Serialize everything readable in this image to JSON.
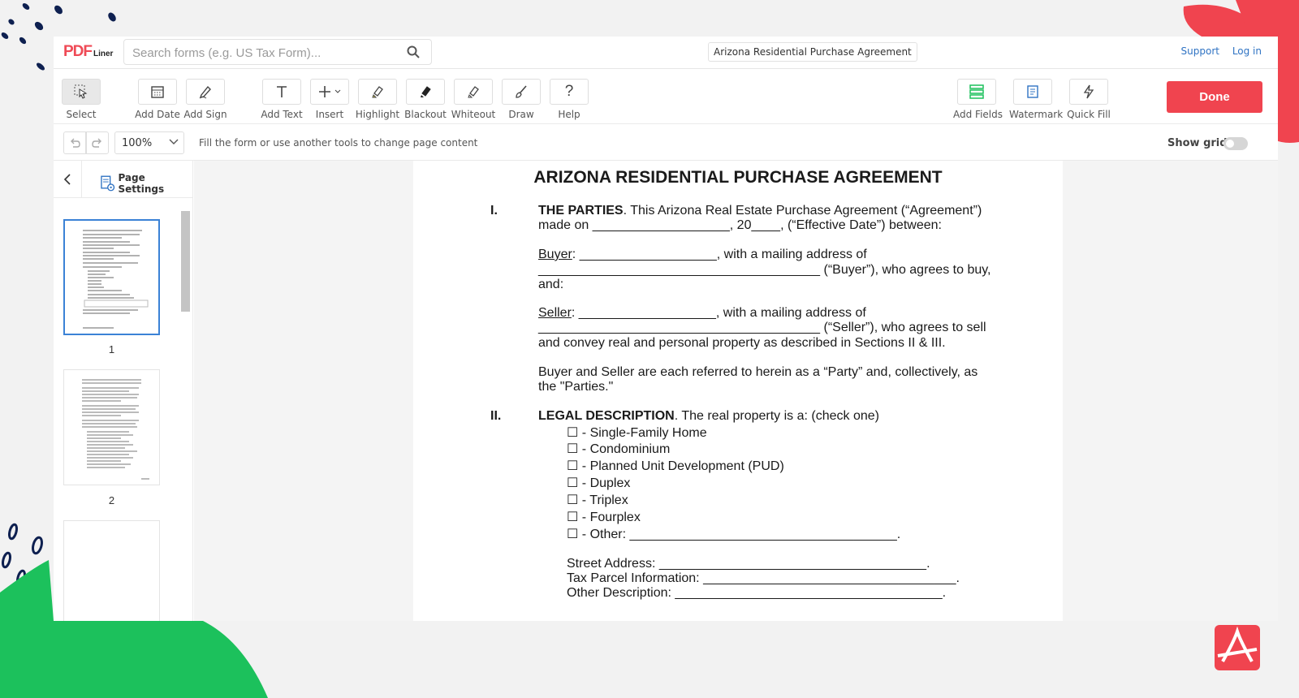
{
  "app": {
    "logo_main": "PDF",
    "logo_sub": "Liner",
    "search_placeholder": "Search forms (e.g. US Tax Form)...",
    "doc_title": "Arizona Residential Purchase Agreement",
    "support": "Support",
    "login": "Log in"
  },
  "toolbar": {
    "select": "Select",
    "add_date": "Add Date",
    "add_sign": "Add Sign",
    "add_text": "Add Text",
    "insert": "Insert",
    "highlight": "Highlight",
    "blackout": "Blackout",
    "whiteout": "Whiteout",
    "draw": "Draw",
    "help": "Help",
    "add_fields": "Add Fields",
    "watermark": "Watermark",
    "quick_fill": "Quick Fill",
    "done": "Done"
  },
  "subbar": {
    "zoom": "100%",
    "hint": "Fill the form or use another tools to change page content",
    "show_grid": "Show grid"
  },
  "sidebar": {
    "page_settings": "Page Settings",
    "pages": [
      "1",
      "2"
    ]
  },
  "document": {
    "title": "ARIZONA RESIDENTIAL PURCHASE AGREEMENT",
    "s1_num": "I.",
    "s1_head": "THE PARTIES",
    "s1_l1": ". This Arizona Real Estate Purchase Agreement (“Agreement”)",
    "s1_l2": "made on ___________________, 20____, (“Effective Date”) between:",
    "buyer_label": "Buyer",
    "buyer_l1": ": ___________________, with a mailing address of",
    "buyer_l2": "_______________________________________ (“Buyer”), who agrees to buy,",
    "buyer_l3": "and:",
    "seller_label": "Seller",
    "seller_l1": ": ___________________, with a mailing address of",
    "seller_l2": "_______________________________________ (“Seller”), who agrees to sell",
    "seller_l3": "and convey real and personal property as described in Sections II & III.",
    "parties_l1": "Buyer and Seller are each referred to herein as a “Party” and, collectively, as",
    "parties_l2": "the \"Parties.\"",
    "s2_num": "II.",
    "s2_head": "LEGAL DESCRIPTION",
    "s2_text": ". The real property is a: (check one)",
    "options": [
      "☐ - Single-Family Home",
      "☐ - Condominium",
      "☐ - Planned Unit Development (PUD)",
      "☐ - Duplex",
      "☐ - Triplex",
      "☐ - Fourplex",
      "☐ - Other: _____________________________________."
    ],
    "street": "Street Address: _____________________________________.",
    "parcel": "Tax Parcel Information: ___________________________________.",
    "other_desc": "Other Description: _____________________________________."
  },
  "colors": {
    "accent": "#f0444f",
    "link": "#2f73c3",
    "green": "#1cc15c",
    "navy": "#0e2050"
  }
}
